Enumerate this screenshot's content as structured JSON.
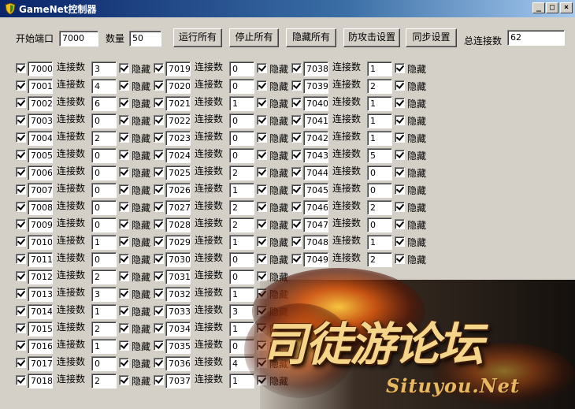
{
  "window": {
    "title": "GameNet控制器",
    "min": "_",
    "max": "□",
    "close": "×"
  },
  "toolbar": {
    "start_port_label": "开始端口",
    "start_port_value": "7000",
    "count_label": "数量",
    "count_value": "50",
    "run_all": "运行所有",
    "stop_all": "停止所有",
    "hide_all": "隐藏所有",
    "anti_attack": "防攻击设置",
    "sync": "同步设置",
    "total_label": "总连接数",
    "total_value": "62"
  },
  "row_labels": {
    "conn": "连接数",
    "hide": "隐藏"
  },
  "ports": [
    {
      "port": "7000",
      "conn": "3"
    },
    {
      "port": "7001",
      "conn": "4"
    },
    {
      "port": "7002",
      "conn": "6"
    },
    {
      "port": "7003",
      "conn": "0"
    },
    {
      "port": "7004",
      "conn": "2"
    },
    {
      "port": "7005",
      "conn": "0"
    },
    {
      "port": "7006",
      "conn": "0"
    },
    {
      "port": "7007",
      "conn": "0"
    },
    {
      "port": "7008",
      "conn": "0"
    },
    {
      "port": "7009",
      "conn": "0"
    },
    {
      "port": "7010",
      "conn": "1"
    },
    {
      "port": "7011",
      "conn": "0"
    },
    {
      "port": "7012",
      "conn": "2"
    },
    {
      "port": "7013",
      "conn": "3"
    },
    {
      "port": "7014",
      "conn": "1"
    },
    {
      "port": "7015",
      "conn": "2"
    },
    {
      "port": "7016",
      "conn": "1"
    },
    {
      "port": "7017",
      "conn": "0"
    },
    {
      "port": "7018",
      "conn": "2"
    },
    {
      "port": "7019",
      "conn": "0"
    },
    {
      "port": "7020",
      "conn": "0"
    },
    {
      "port": "7021",
      "conn": "1"
    },
    {
      "port": "7022",
      "conn": "0"
    },
    {
      "port": "7023",
      "conn": "0"
    },
    {
      "port": "7024",
      "conn": "0"
    },
    {
      "port": "7025",
      "conn": "2"
    },
    {
      "port": "7026",
      "conn": "1"
    },
    {
      "port": "7027",
      "conn": "2"
    },
    {
      "port": "7028",
      "conn": "2"
    },
    {
      "port": "7029",
      "conn": "1"
    },
    {
      "port": "7030",
      "conn": "0"
    },
    {
      "port": "7031",
      "conn": "0"
    },
    {
      "port": "7032",
      "conn": "1"
    },
    {
      "port": "7033",
      "conn": "3"
    },
    {
      "port": "7034",
      "conn": "1"
    },
    {
      "port": "7035",
      "conn": "0"
    },
    {
      "port": "7036",
      "conn": "4"
    },
    {
      "port": "7037",
      "conn": "1"
    },
    {
      "port": "7038",
      "conn": "1"
    },
    {
      "port": "7039",
      "conn": "2"
    },
    {
      "port": "7040",
      "conn": "1"
    },
    {
      "port": "7041",
      "conn": "1"
    },
    {
      "port": "7042",
      "conn": "1"
    },
    {
      "port": "7043",
      "conn": "5"
    },
    {
      "port": "7044",
      "conn": "0"
    },
    {
      "port": "7045",
      "conn": "0"
    },
    {
      "port": "7046",
      "conn": "2"
    },
    {
      "port": "7047",
      "conn": "0"
    },
    {
      "port": "7048",
      "conn": "1"
    },
    {
      "port": "7049",
      "conn": "2"
    }
  ],
  "watermark": {
    "text": "司徒游论坛",
    "sub": "Situyou.Net"
  }
}
